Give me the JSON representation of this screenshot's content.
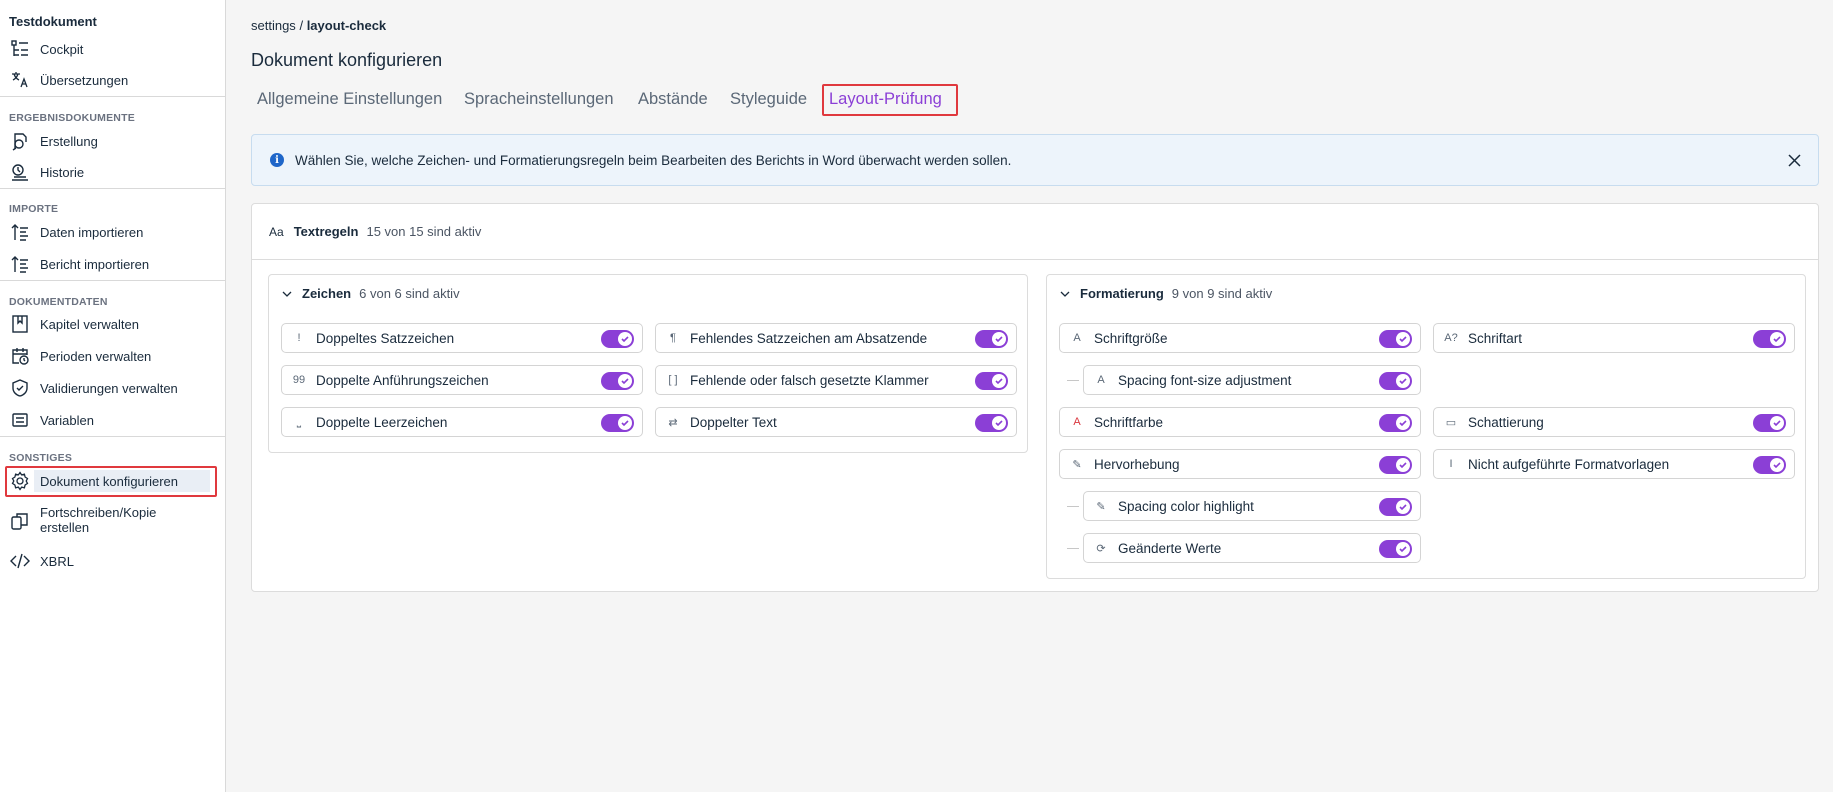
{
  "sidebar": {
    "doc_title": "Testdokument",
    "top_items": [
      {
        "label": "Cockpit",
        "icon": "cockpit-icon"
      },
      {
        "label": "Übersetzungen",
        "icon": "translate-icon"
      }
    ],
    "sections": [
      {
        "title": "ERGEBNISDOKUMENTE",
        "items": [
          {
            "label": "Erstellung",
            "icon": "create-document-icon"
          },
          {
            "label": "Historie",
            "icon": "history-icon"
          }
        ]
      },
      {
        "title": "IMPORTE",
        "items": [
          {
            "label": "Daten importieren",
            "icon": "import-data-icon"
          },
          {
            "label": "Bericht importieren",
            "icon": "import-report-icon"
          }
        ]
      },
      {
        "title": "DOKUMENTDATEN",
        "items": [
          {
            "label": "Kapitel verwalten",
            "icon": "book-icon"
          },
          {
            "label": "Perioden verwalten",
            "icon": "calendar-clock-icon"
          },
          {
            "label": "Validierungen verwalten",
            "icon": "shield-check-icon"
          },
          {
            "label": "Variablen",
            "icon": "variables-icon"
          }
        ]
      },
      {
        "title": "SONSTIGES",
        "items": [
          {
            "label": "Dokument konfigurieren",
            "icon": "gear-icon",
            "active": true
          },
          {
            "label": "Fortschreiben/Kopie erstellen",
            "icon": "copy-icon"
          },
          {
            "label": "XBRL",
            "icon": "code-icon"
          }
        ]
      }
    ]
  },
  "breadcrumb": {
    "root": "settings",
    "separator": "/",
    "current": "layout-check"
  },
  "page_title": "Dokument konfigurieren",
  "tabs": [
    {
      "label": "Allgemeine Einstellungen"
    },
    {
      "label": "Spracheinstellungen"
    },
    {
      "label": "Abstände"
    },
    {
      "label": "Styleguide"
    },
    {
      "label": "Layout-Prüfung",
      "active": true
    }
  ],
  "info_banner": {
    "icon": "info-icon",
    "text": "Wählen Sie, welche Zeichen- und Formatierungsregeln beim Bearbeiten des Berichts in Word überwacht werden sollen.",
    "close_icon": "close-icon"
  },
  "text_rules": {
    "icon_text": "Aa",
    "title": "Textregeln",
    "count": "15 von 15 sind aktiv",
    "groups": [
      {
        "name": "Zeichen",
        "count": "6 von 6 sind aktiv",
        "rules": [
          {
            "label": "Doppeltes Satzzeichen",
            "icon": "exclamation-icon",
            "glyph": "!",
            "on": true
          },
          {
            "label": "Fehlendes Satzzeichen am Absatzende",
            "icon": "pilcrow-icon",
            "glyph": "¶",
            "on": true
          },
          {
            "label": "Doppelte Anführungszeichen",
            "icon": "quote-icon",
            "glyph": "99",
            "on": true
          },
          {
            "label": "Fehlende oder falsch gesetzte Klammer",
            "icon": "brackets-icon",
            "glyph": "[ ]",
            "on": true
          },
          {
            "label": "Doppelte Leerzeichen",
            "icon": "double-space-icon",
            "glyph": "⎵",
            "on": true
          },
          {
            "label": "Doppelter Text",
            "icon": "repeat-icon",
            "glyph": "⇄",
            "on": true
          }
        ]
      },
      {
        "name": "Formatierung",
        "count": "9 von 9 sind aktiv",
        "rules": [
          {
            "label": "Schriftgröße",
            "icon": "font-size-icon",
            "glyph": "A",
            "on": true
          },
          {
            "label": "Schriftart",
            "icon": "font-family-icon",
            "glyph": "A?",
            "on": true
          },
          {
            "label": "Spacing font-size adjustment",
            "icon": "font-size-icon",
            "glyph": "A",
            "on": true,
            "child": true
          },
          {
            "label": "Schriftfarbe",
            "icon": "font-color-icon",
            "glyph": "A",
            "on": true,
            "red": true
          },
          {
            "label": "Schattierung",
            "icon": "shading-icon",
            "glyph": "▭",
            "on": true
          },
          {
            "label": "Hervorhebung",
            "icon": "highlighter-icon",
            "glyph": "✎",
            "on": true
          },
          {
            "label": "Nicht aufgeführte Formatvorlagen",
            "icon": "text-cursor-icon",
            "glyph": "I",
            "on": true
          },
          {
            "label": "Spacing color highlight",
            "icon": "highlighter-icon",
            "glyph": "✎",
            "on": true,
            "child": true
          },
          {
            "label": "Geänderte Werte",
            "icon": "refresh-icon",
            "glyph": "⟳",
            "on": true,
            "child": true
          }
        ]
      }
    ]
  },
  "colors": {
    "accent": "#8b3fd6",
    "highlight_box": "#e0393e",
    "info_bg": "#edf4fb",
    "info_icon": "#1f66c9"
  }
}
